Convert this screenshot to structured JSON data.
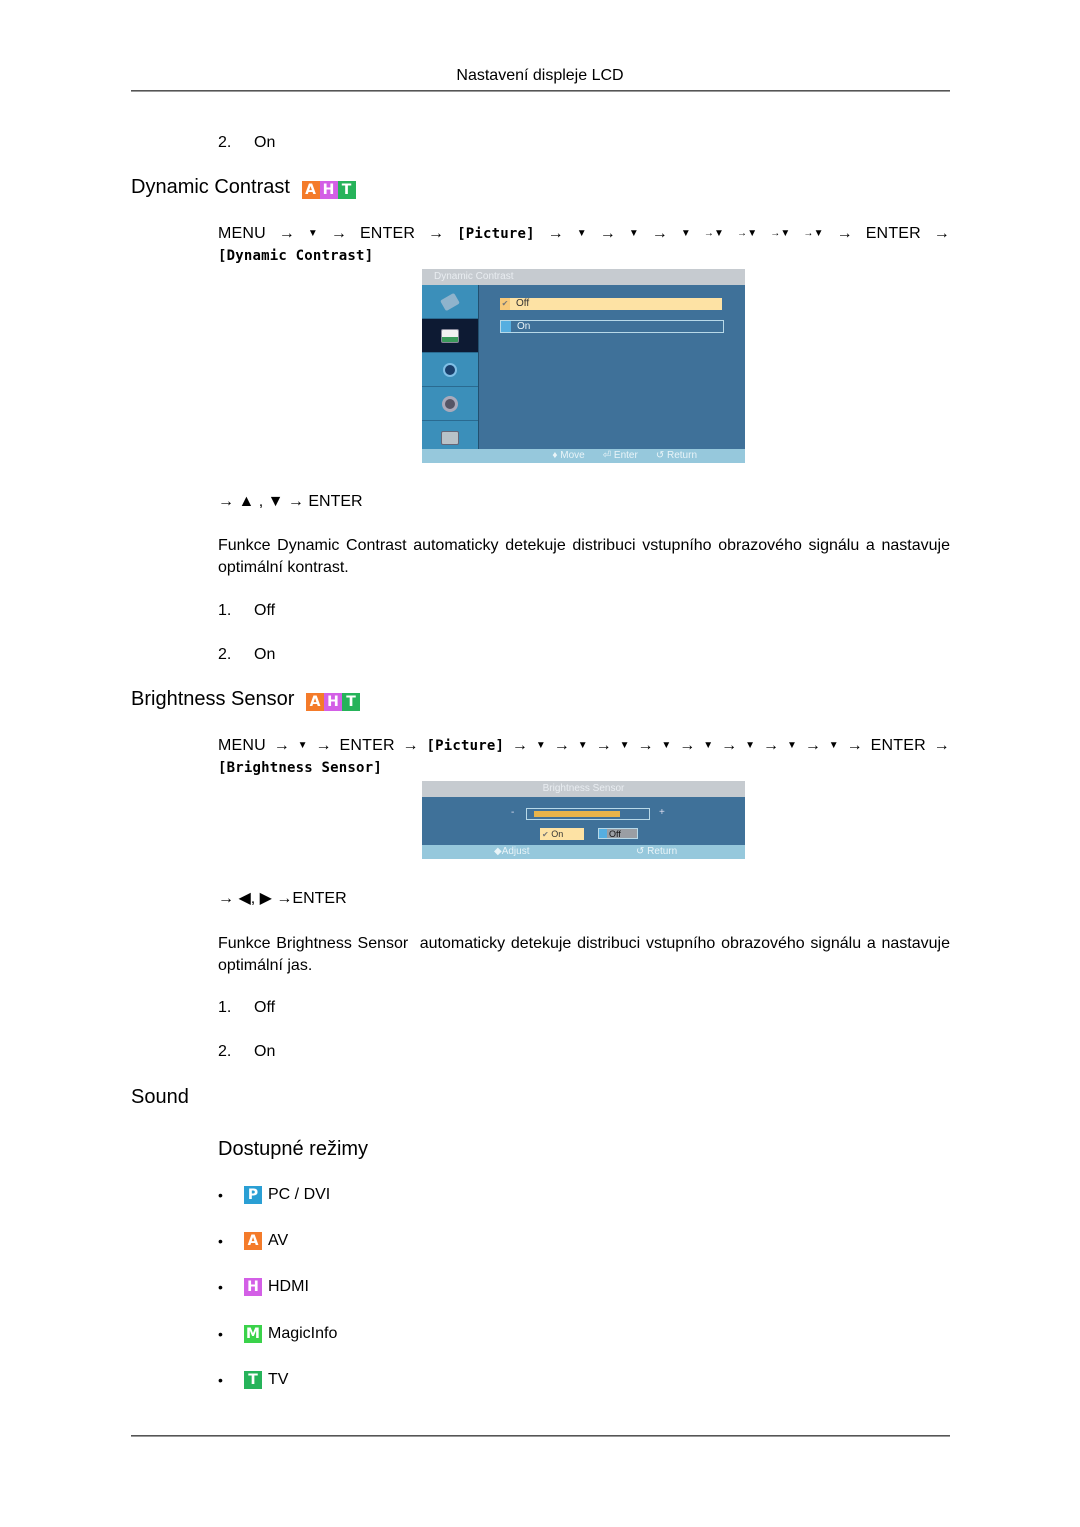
{
  "header": {
    "title": "Nastavení displeje LCD"
  },
  "top_list_item": {
    "number": "2.",
    "label": "On"
  },
  "dynamic_contrast": {
    "heading": "Dynamic Contrast",
    "badges": [
      "A",
      "H",
      "T"
    ],
    "nav_path": {
      "line1": [
        "MENU",
        "→",
        "▼",
        "→",
        "ENTER",
        "→",
        "[Picture]",
        "→",
        "▼",
        "→",
        "▼",
        "→",
        "▼",
        "→▼",
        "→▼",
        "→▼",
        "→▼",
        "→",
        "ENTER",
        "→"
      ],
      "line2": "[Dynamic Contrast]"
    },
    "osd": {
      "title": "Dynamic Contrast",
      "sidebar_icons": [
        "input-icon",
        "picture-icon",
        "sound-icon",
        "setup-icon",
        "multi-control-icon"
      ],
      "selected_sidebar_index": 1,
      "options": [
        {
          "label": "Off",
          "checked": true
        },
        {
          "label": "On",
          "checked": false
        }
      ],
      "footer": [
        {
          "icon": "updown-icon",
          "label": "Move"
        },
        {
          "icon": "enter-icon",
          "label": "Enter"
        },
        {
          "icon": "return-icon",
          "label": "Return"
        }
      ]
    },
    "after_nav": "→ ▲ , ▼ → ENTER",
    "description": {
      "prefix": "Funkce ",
      "term": "Dynamic Contrast",
      "suffix": " automaticky detekuje distribuci vstupního obrazového signálu a nastavuje optimální kontrast."
    },
    "options": [
      {
        "number": "1.",
        "label": "Off"
      },
      {
        "number": "2.",
        "label": "On"
      }
    ]
  },
  "brightness_sensor": {
    "heading": "Brightness Sensor",
    "badges": [
      "A",
      "H",
      "T"
    ],
    "nav_path": {
      "line1": [
        "MENU",
        "→",
        "▼",
        "→",
        "ENTER",
        "→",
        "[Picture]",
        "→",
        "▼",
        "→",
        "▼",
        "→",
        "▼",
        "→",
        "▼",
        "→",
        "▼",
        "→",
        "▼",
        "→",
        "▼",
        "→",
        "▼",
        "→",
        "ENTER",
        "→"
      ],
      "line2": "[Brightness Sensor]"
    },
    "osd": {
      "title": "Brightness Sensor",
      "minus": "-",
      "plus": "+",
      "level_fraction": 0.8,
      "buttons": [
        {
          "label": "On",
          "checked": true
        },
        {
          "label": "Off",
          "checked": false
        }
      ],
      "footer": [
        {
          "icon": "leftright-icon",
          "label": "Adjust"
        },
        {
          "icon": "return-icon",
          "label": "Return"
        }
      ]
    },
    "after_nav": "→ ◀, ▶ →ENTER",
    "description": {
      "prefix": "Funkce ",
      "term": "Brightness Sensor",
      "suffix": "  automaticky detekuje distribuci vstupního obrazového signálu a nastavuje optimální jas."
    },
    "options": [
      {
        "number": "1.",
        "label": "Off"
      },
      {
        "number": "2.",
        "label": "On"
      }
    ]
  },
  "sound": {
    "heading": "Sound",
    "subheading": "Dostupné režimy",
    "modes": [
      {
        "badge": "P",
        "label": "PC / DVI"
      },
      {
        "badge": "A",
        "label": "AV"
      },
      {
        "badge": "H",
        "label": "HDMI"
      },
      {
        "badge": "M",
        "label": "MagicInfo"
      },
      {
        "badge": "T",
        "label": "TV"
      }
    ]
  },
  "colors": {
    "badge_a": "#f47b2a",
    "badge_h": "#d35fe6",
    "badge_t": "#26b35a",
    "badge_p": "#2a9fd4",
    "badge_m": "#3ad24a",
    "osd_bg": "#3f7199",
    "osd_highlight": "#fde2a4",
    "osd_bar": "#e8b44a"
  }
}
